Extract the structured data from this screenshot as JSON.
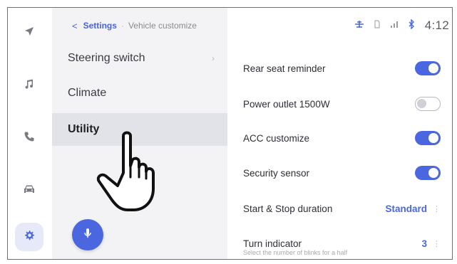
{
  "header": {
    "back_glyph": "<",
    "settings_label": "Settings",
    "separator": "·",
    "page_label": "Vehicle customize",
    "clock": "4:12"
  },
  "rail": {
    "icons": [
      "navigation-icon",
      "music-icon",
      "phone-icon",
      "car-icon",
      "gear-icon"
    ]
  },
  "menu": {
    "items": [
      {
        "label": "Steering switch",
        "chevron": "›"
      },
      {
        "label": "Climate"
      },
      {
        "label": "Utility",
        "selected": true
      }
    ]
  },
  "settings": {
    "rows": [
      {
        "label": "Rear seat reminder",
        "toggle": "on"
      },
      {
        "label": "Power outlet 1500W",
        "toggle": "off"
      },
      {
        "label": "ACC customize",
        "toggle": "on"
      },
      {
        "label": "Security sensor",
        "toggle": "on"
      },
      {
        "label": "Start & Stop duration",
        "value": "Standard",
        "dots": "⋮"
      },
      {
        "label": "Turn indicator",
        "value": "3",
        "dots": "⋮",
        "sublabel": "Select the number of blinks for a half"
      }
    ]
  },
  "colors": {
    "accent": "#4a67df",
    "menu_bg": "#f3f3f6",
    "selected_bg": "#e2e3e8"
  }
}
